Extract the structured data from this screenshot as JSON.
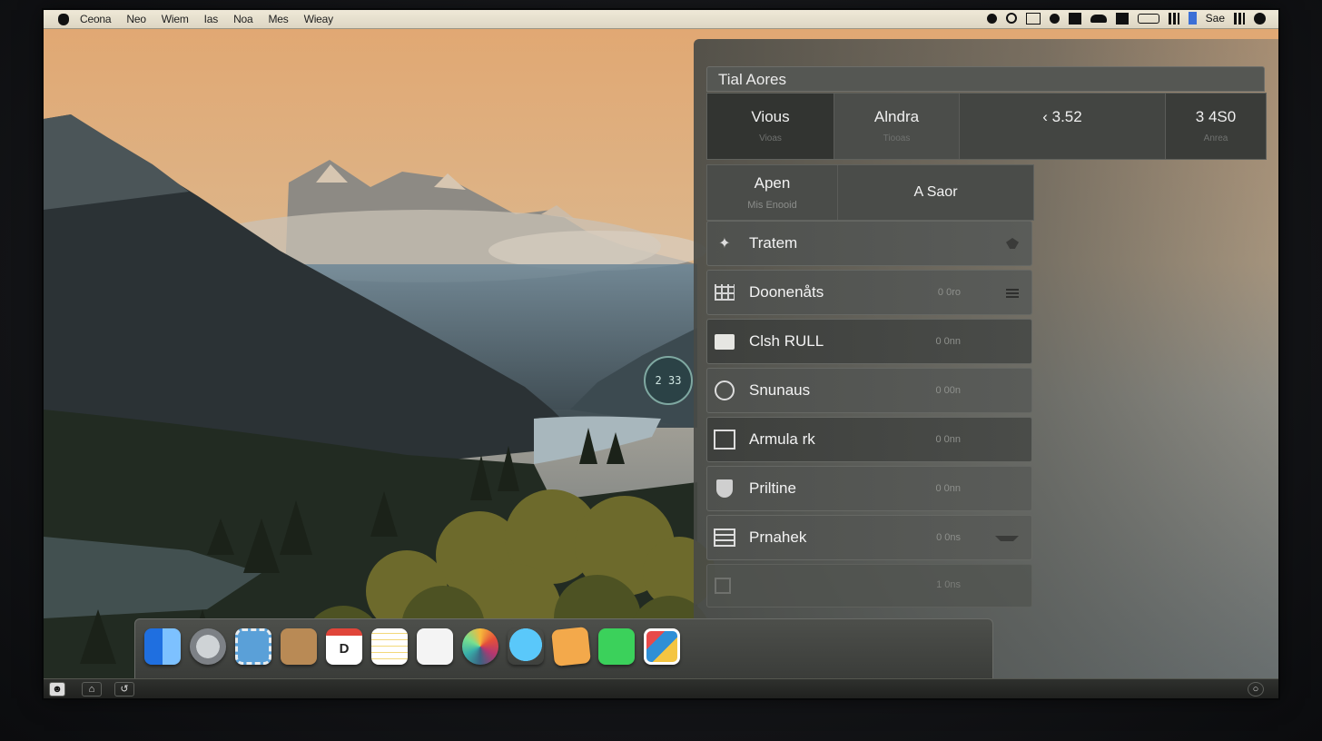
{
  "menubar": {
    "items": [
      "Ceona",
      "Neo",
      "Wiem",
      "Ias",
      "Noa",
      "Mes",
      "Wieay"
    ],
    "status_text": "Sae"
  },
  "panel": {
    "title": "Tial Aores",
    "summary": [
      {
        "label": "Vious",
        "sub": "Vioas"
      },
      {
        "label": "Alndra",
        "sub": "Tiooas"
      },
      {
        "label": "‹ 3.52",
        "sub": ""
      },
      {
        "label": "3 4S0",
        "sub": "Anrea"
      }
    ],
    "app_header": {
      "left_label": "Apen",
      "left_sub": "Mis Enooid",
      "right_label": "A Saor"
    },
    "rows": [
      {
        "label": "Tratem",
        "value": "",
        "icon": "plus-icon",
        "end": "pin-icon"
      },
      {
        "label": "Doonenåts",
        "value": "0 0ro",
        "icon": "grid-icon",
        "end": "menu-icon"
      },
      {
        "label": "Clsh RULL",
        "value": "0 0nn",
        "icon": "folder-icon",
        "end": ""
      },
      {
        "label": "Snunaus",
        "value": "0 00n",
        "icon": "disc-icon",
        "end": ""
      },
      {
        "label": "Armula rk",
        "value": "0 0nn",
        "icon": "image-icon",
        "end": ""
      },
      {
        "label": "Priltine",
        "value": "0 0nn",
        "icon": "shield-icon",
        "end": ""
      },
      {
        "label": "Prnahek",
        "value": "0 0ns",
        "icon": "list-icon",
        "end": "chevron-down-icon"
      }
    ],
    "ghost_row": {
      "value": "1 0ns"
    }
  },
  "hud": {
    "text": "2 33"
  },
  "dock": {
    "apps": [
      "finder-icon",
      "launchpad-icon",
      "mail-stamp-icon",
      "contacts-icon",
      "calendar-icon",
      "notes-icon",
      "reminders-icon",
      "photos-icon",
      "messages-icon",
      "stickies-icon",
      "facetime-icon",
      "photo-booth-icon"
    ],
    "calendar_day": "D"
  },
  "colors": {
    "menubar": "#e6e0cd",
    "panel": "#4f514e",
    "accent_blue": "#3b6fd6"
  }
}
